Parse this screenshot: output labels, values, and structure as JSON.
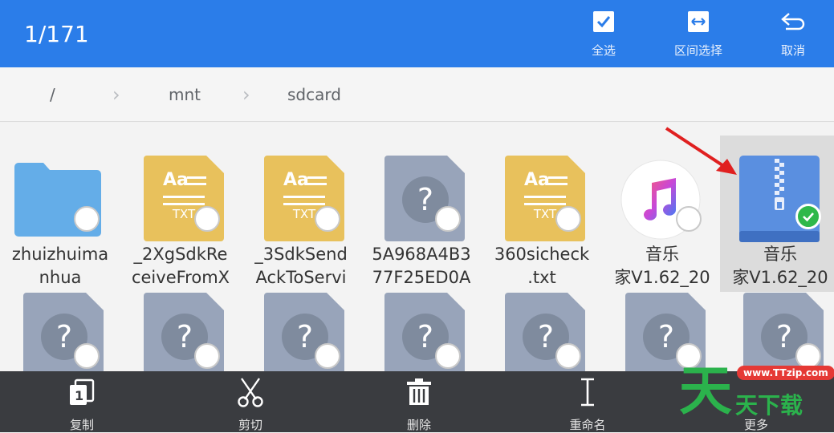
{
  "topbar": {
    "selection_count": "1/171",
    "actions": [
      {
        "label": "全选",
        "icon": "checkbox-checked-icon"
      },
      {
        "label": "区间选择",
        "icon": "range-select-icon"
      },
      {
        "label": "取消",
        "icon": "return-icon"
      }
    ]
  },
  "breadcrumb": [
    "/",
    "mnt",
    "sdcard"
  ],
  "grid": {
    "row1": [
      {
        "name": "zhuizhuima\nnhua",
        "type": "folder",
        "selected": false
      },
      {
        "name": "_2XgSdkRe\nceiveFromX",
        "type": "txt",
        "selected": false
      },
      {
        "name": "_3SdkSend\nAckToServi",
        "type": "txt",
        "selected": false
      },
      {
        "name": "5A968A4B3\n77F25ED0A",
        "type": "unknown",
        "selected": false
      },
      {
        "name": "360sicheck\n.txt",
        "type": "txt",
        "selected": false
      },
      {
        "name": "音乐\n家V1.62_20",
        "type": "music",
        "selected": false
      },
      {
        "name": "音乐\n家V1.62_20",
        "type": "zip",
        "selected": true
      }
    ],
    "row2_types": [
      "unknown",
      "unknown",
      "unknown",
      "unknown",
      "unknown",
      "unknown",
      "unknown"
    ],
    "txt_badge": "TXT",
    "txt_glyph": "Aa",
    "unknown_glyph": "?"
  },
  "bottombar": {
    "actions": [
      {
        "label": "复制",
        "icon": "copy-icon"
      },
      {
        "label": "剪切",
        "icon": "scissors-icon"
      },
      {
        "label": "删除",
        "icon": "trash-icon"
      },
      {
        "label": "重命名",
        "icon": "rename-icon"
      },
      {
        "label": "更多",
        "icon": "more-icon"
      }
    ]
  },
  "watermark": {
    "url": "www.TTzip.com",
    "big": "天",
    "small": "天下载"
  },
  "colors": {
    "accent": "#2b7de9",
    "txt_file": "#e8c15c",
    "unknown_file": "#98a4ba",
    "folder": "#64ade8",
    "zip": "#5a8fe0",
    "check": "#2fb84a",
    "arrow": "#e02020"
  }
}
